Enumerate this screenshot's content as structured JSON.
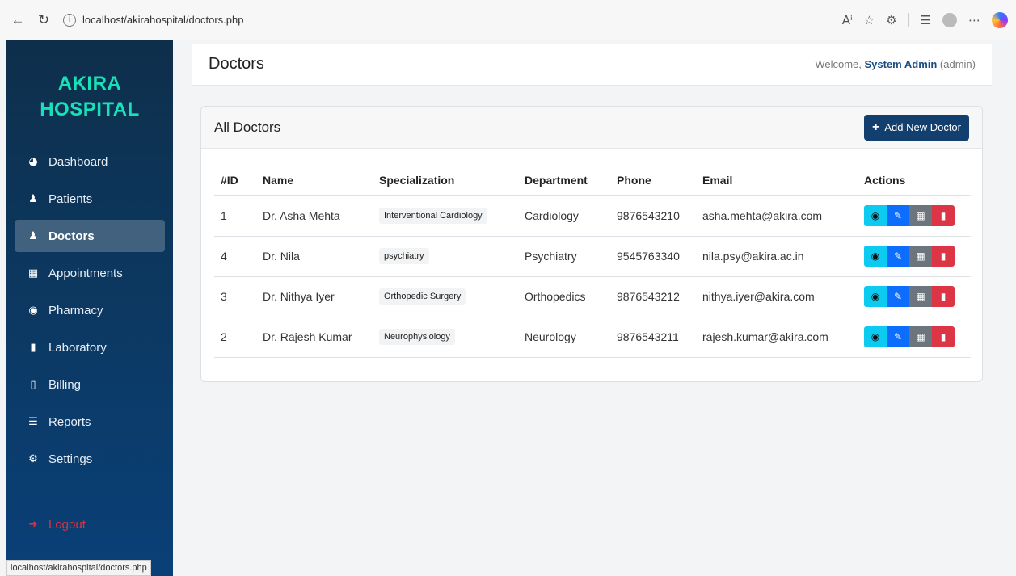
{
  "browser": {
    "url": "localhost/akirahospital/doctors.php"
  },
  "sidebar": {
    "brand_line1": "AKIRA",
    "brand_line2": "HOSPITAL",
    "items": [
      {
        "label": "Dashboard",
        "icon": "dashboard-icon"
      },
      {
        "label": "Patients",
        "icon": "patients-icon"
      },
      {
        "label": "Doctors",
        "icon": "doctor-icon",
        "active": true
      },
      {
        "label": "Appointments",
        "icon": "calendar-icon"
      },
      {
        "label": "Pharmacy",
        "icon": "pills-icon"
      },
      {
        "label": "Laboratory",
        "icon": "flask-icon"
      },
      {
        "label": "Billing",
        "icon": "invoice-icon"
      },
      {
        "label": "Reports",
        "icon": "chart-icon"
      },
      {
        "label": "Settings",
        "icon": "gear-icon"
      }
    ],
    "logout": "Logout",
    "status_url": "localhost/akirahospital/doctors.php"
  },
  "header": {
    "title": "Doctors",
    "welcome_prefix": "Welcome, ",
    "user_name": "System Admin",
    "user_role": " (admin)"
  },
  "card": {
    "title": "All Doctors",
    "add_button": "Add New Doctor",
    "columns": [
      "#ID",
      "Name",
      "Specialization",
      "Department",
      "Phone",
      "Email",
      "Actions"
    ],
    "rows": [
      {
        "id": "1",
        "name": "Dr. Asha Mehta",
        "specialization": "Interventional Cardiology",
        "department": "Cardiology",
        "phone": "9876543210",
        "email": "asha.mehta@akira.com"
      },
      {
        "id": "4",
        "name": "Dr. Nila",
        "specialization": "psychiatry",
        "department": "Psychiatry",
        "phone": "9545763340",
        "email": "nila.psy@akira.ac.in"
      },
      {
        "id": "3",
        "name": "Dr. Nithya Iyer",
        "specialization": "Orthopedic Surgery",
        "department": "Orthopedics",
        "phone": "9876543212",
        "email": "nithya.iyer@akira.com"
      },
      {
        "id": "2",
        "name": "Dr. Rajesh Kumar",
        "specialization": "Neurophysiology",
        "department": "Neurology",
        "phone": "9876543211",
        "email": "rajesh.kumar@akira.com"
      }
    ]
  },
  "colors": {
    "sidebar": "#0e2f4b",
    "brand": "#18e0b8",
    "primary_button": "#123f6e",
    "view": "#0dcaf0",
    "edit": "#0d6efd",
    "schedule": "#6c757d",
    "delete": "#dc3545"
  }
}
